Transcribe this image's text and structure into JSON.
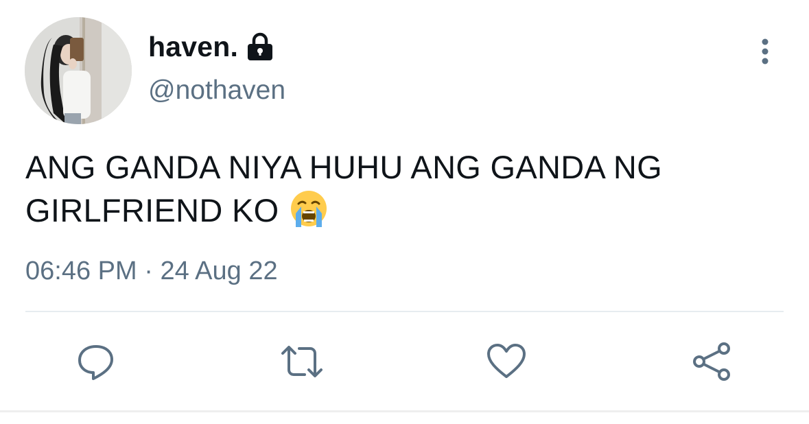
{
  "user": {
    "display_name": "haven.",
    "handle": "@nothaven",
    "protected_icon": "lock-icon",
    "avatar_icon": "profile-photo"
  },
  "tweet": {
    "text": "ANG GANDA NIYA HUHU ANG GANDA NG GIRLFRIEND KO",
    "emoji": "loudly-crying-face",
    "time": "06:46 PM",
    "separator": "·",
    "date": "24 Aug 22"
  },
  "menu": {
    "icon": "more-vertical-icon"
  },
  "actions": [
    {
      "name": "reply",
      "icon": "reply-icon"
    },
    {
      "name": "retweet",
      "icon": "retweet-icon"
    },
    {
      "name": "like",
      "icon": "heart-icon"
    },
    {
      "name": "share",
      "icon": "share-icon"
    }
  ],
  "colors": {
    "text": "#0f1419",
    "secondary": "#5b7083",
    "divider": "#e6ecf0"
  }
}
